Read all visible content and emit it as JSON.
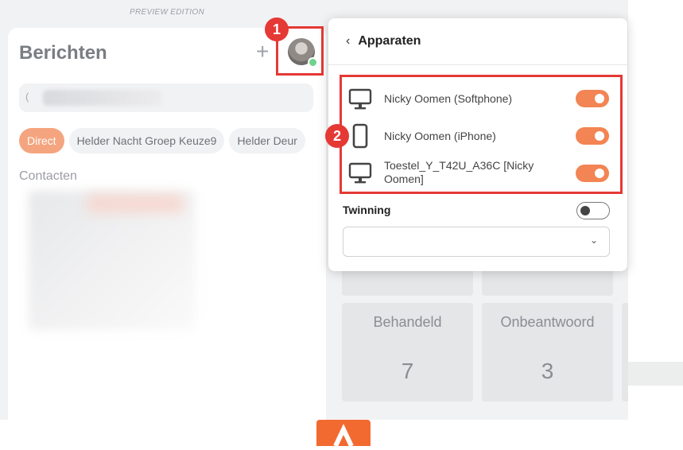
{
  "edition_banner": "PREVIEW EDITION",
  "messages": {
    "title": "Berichten",
    "add_symbol": "+",
    "search_prefix": "(",
    "chips": [
      "Direct",
      "Helder Nacht Groep Keuze9",
      "Helder Deur"
    ],
    "contacts_heading": "Contacten"
  },
  "annotations": {
    "first": "1",
    "second": "2"
  },
  "devices_panel": {
    "back_symbol": "‹",
    "title": "Apparaten",
    "devices": [
      {
        "name": "Nicky Oomen (Softphone)",
        "icon": "desktop-icon",
        "enabled": true
      },
      {
        "name": "Nicky Oomen (iPhone)",
        "icon": "phone-icon",
        "enabled": true
      },
      {
        "name": "Toestel_Y_T42U_A36C [Nicky Oomen]",
        "icon": "desktop-icon",
        "enabled": true
      }
    ],
    "twinning": {
      "label": "Twinning",
      "enabled": false,
      "selected": "",
      "chevron": "⌄"
    }
  },
  "stats": [
    {
      "label": "Behandeld",
      "value": "7"
    },
    {
      "label": "Onbeantwoord",
      "value": "3"
    }
  ],
  "colors": {
    "accent": "#f38454",
    "highlight": "#e53935",
    "chip_active": "#f4a57f"
  }
}
